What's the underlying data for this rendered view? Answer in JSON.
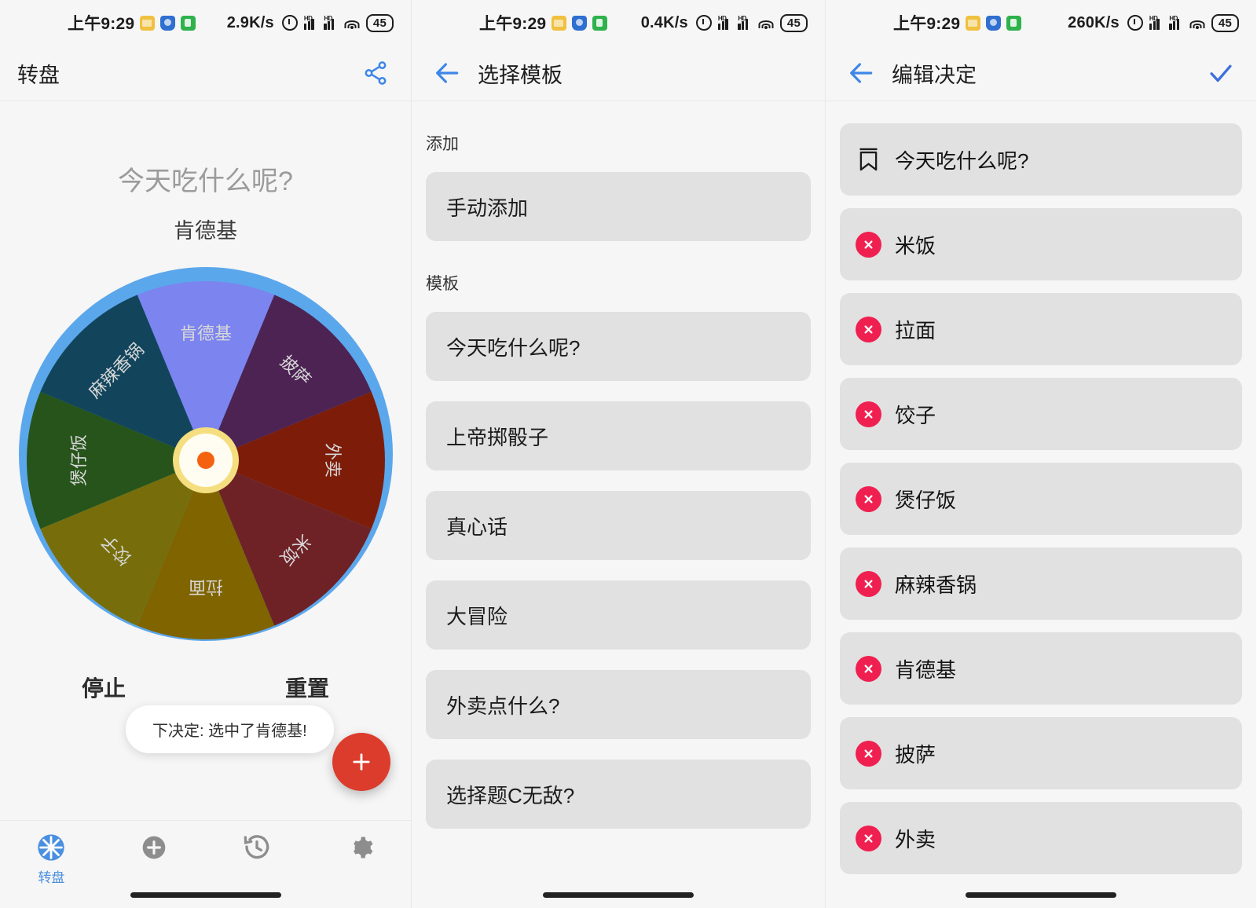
{
  "statusbar": {
    "time": "上午9:29",
    "speeds": [
      "2.9K/s",
      "0.4K/s",
      "260K/s"
    ],
    "battery": "45",
    "hd_label": "HD",
    "icons": [
      "files-icon",
      "shield-icon",
      "phone-icon",
      "alarm-icon",
      "signal-icon",
      "signal-icon",
      "wifi-icon",
      "battery-icon"
    ]
  },
  "screen1": {
    "appbar": {
      "title": "转盘",
      "share_icon": "share-icon"
    },
    "wheel": {
      "title": "今天吃什么呢?",
      "result": "肯德基",
      "rim_color": "#5ba7ec",
      "hub_ring_color": "#f4de7f",
      "hub_dot_color": "#f4620f",
      "segments": [
        {
          "label": "肯德基",
          "color": "#7b84ef"
        },
        {
          "label": "披萨",
          "color": "#4c2353"
        },
        {
          "label": "外卖",
          "color": "#7d1d09"
        },
        {
          "label": "米饭",
          "color": "#6e2226"
        },
        {
          "label": "拉面",
          "color": "#7f6400"
        },
        {
          "label": "饺子",
          "color": "#776e0b"
        },
        {
          "label": "煲仔饭",
          "color": "#27541b"
        },
        {
          "label": "麻辣香锅",
          "color": "#12455c"
        }
      ]
    },
    "actions": {
      "stop": "停止",
      "reset": "重置"
    },
    "toast": "下决定: 选中了肯德基!",
    "fab_label": "+",
    "bottomnav": [
      {
        "label": "转盘",
        "icon": "wheel-icon",
        "active": true
      },
      {
        "label": "",
        "icon": "plus-circle-icon",
        "active": false
      },
      {
        "label": "",
        "icon": "history-icon",
        "active": false
      },
      {
        "label": "",
        "icon": "gear-icon",
        "active": false
      }
    ]
  },
  "screen2": {
    "appbar": {
      "title": "选择模板",
      "back_icon": "back-arrow-icon"
    },
    "add_section_label": "添加",
    "add_items": [
      "手动添加"
    ],
    "template_section_label": "模板",
    "templates": [
      "今天吃什么呢?",
      "上帝掷骰子",
      "真心话",
      "大冒险",
      "外卖点什么?",
      "选择题C无敌?"
    ]
  },
  "screen3": {
    "appbar": {
      "title": "编辑决定",
      "back_icon": "back-arrow-icon",
      "confirm_icon": "check-icon"
    },
    "title_row": {
      "label": "今天吃什么呢?",
      "icon": "bookmark-icon"
    },
    "options": [
      "米饭",
      "拉面",
      "饺子",
      "煲仔饭",
      "麻辣香锅",
      "肯德基",
      "披萨",
      "外卖"
    ],
    "delete_icon": "delete-circle-icon",
    "accent_color": "#ef2050"
  }
}
